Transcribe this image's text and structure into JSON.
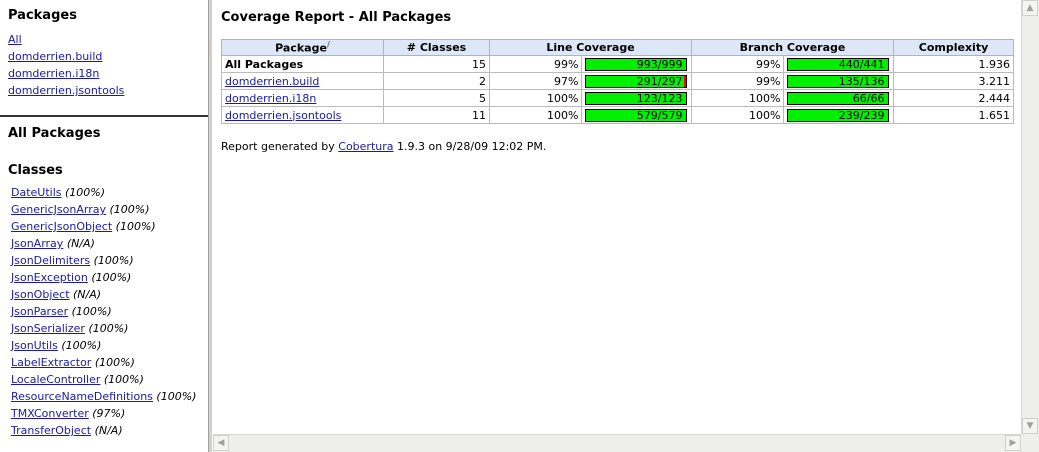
{
  "packages_frame": {
    "title": "Packages",
    "items": [
      {
        "label": "All"
      },
      {
        "label": "domderrien.build"
      },
      {
        "label": "domderrien.i18n"
      },
      {
        "label": "domderrien.jsontools"
      }
    ]
  },
  "classes_frame": {
    "section_title": "All Packages",
    "classes_title": "Classes",
    "items": [
      {
        "name": "DateUtils",
        "pct": "(100%)"
      },
      {
        "name": "GenericJsonArray",
        "pct": "(100%)"
      },
      {
        "name": "GenericJsonObject",
        "pct": "(100%)"
      },
      {
        "name": "JsonArray",
        "pct": "(N/A)"
      },
      {
        "name": "JsonDelimiters",
        "pct": "(100%)"
      },
      {
        "name": "JsonException",
        "pct": "(100%)"
      },
      {
        "name": "JsonObject",
        "pct": "(N/A)"
      },
      {
        "name": "JsonParser",
        "pct": "(100%)"
      },
      {
        "name": "JsonSerializer",
        "pct": "(100%)"
      },
      {
        "name": "JsonUtils",
        "pct": "(100%)"
      },
      {
        "name": "LabelExtractor",
        "pct": "(100%)"
      },
      {
        "name": "LocaleController",
        "pct": "(100%)"
      },
      {
        "name": "ResourceNameDefinitions",
        "pct": "(100%)"
      },
      {
        "name": "TMXConverter",
        "pct": "(97%)"
      },
      {
        "name": "TransferObject",
        "pct": "(N/A)"
      }
    ]
  },
  "report": {
    "title": "Coverage Report - All Packages",
    "headers": {
      "package": "Package",
      "sort_marker": "/",
      "classes": "# Classes",
      "line": "Line Coverage",
      "branch": "Branch Coverage",
      "complexity": "Complexity"
    },
    "rows": [
      {
        "name": "All Packages",
        "classes": "15",
        "line_pct": "99%",
        "line_ratio": "993/999",
        "line_fill": 99.4,
        "branch_pct": "99%",
        "branch_ratio": "440/441",
        "branch_fill": 99.8,
        "complexity": "1.936"
      },
      {
        "name": "domderrien.build",
        "classes": "2",
        "line_pct": "97%",
        "line_ratio": "291/297",
        "line_fill": 98.0,
        "branch_pct": "99%",
        "branch_ratio": "135/136",
        "branch_fill": 99.3,
        "complexity": "3.211"
      },
      {
        "name": "domderrien.i18n",
        "classes": "5",
        "line_pct": "100%",
        "line_ratio": "123/123",
        "line_fill": 100,
        "branch_pct": "100%",
        "branch_ratio": "66/66",
        "branch_fill": 100,
        "complexity": "2.444"
      },
      {
        "name": "domderrien.jsontools",
        "classes": "11",
        "line_pct": "100%",
        "line_ratio": "579/579",
        "line_fill": 100,
        "branch_pct": "100%",
        "branch_ratio": "239/239",
        "branch_fill": 100,
        "complexity": "1.651"
      }
    ],
    "footer": {
      "prefix": "Report generated by ",
      "link": "Cobertura",
      "suffix": " 1.9.3 on 9/28/09 12:02 PM."
    }
  },
  "colors": {
    "covered": "#00f000",
    "uncovered": "#ff0000",
    "header_bg": "#dee7f7",
    "link": "#1a1aa6"
  }
}
